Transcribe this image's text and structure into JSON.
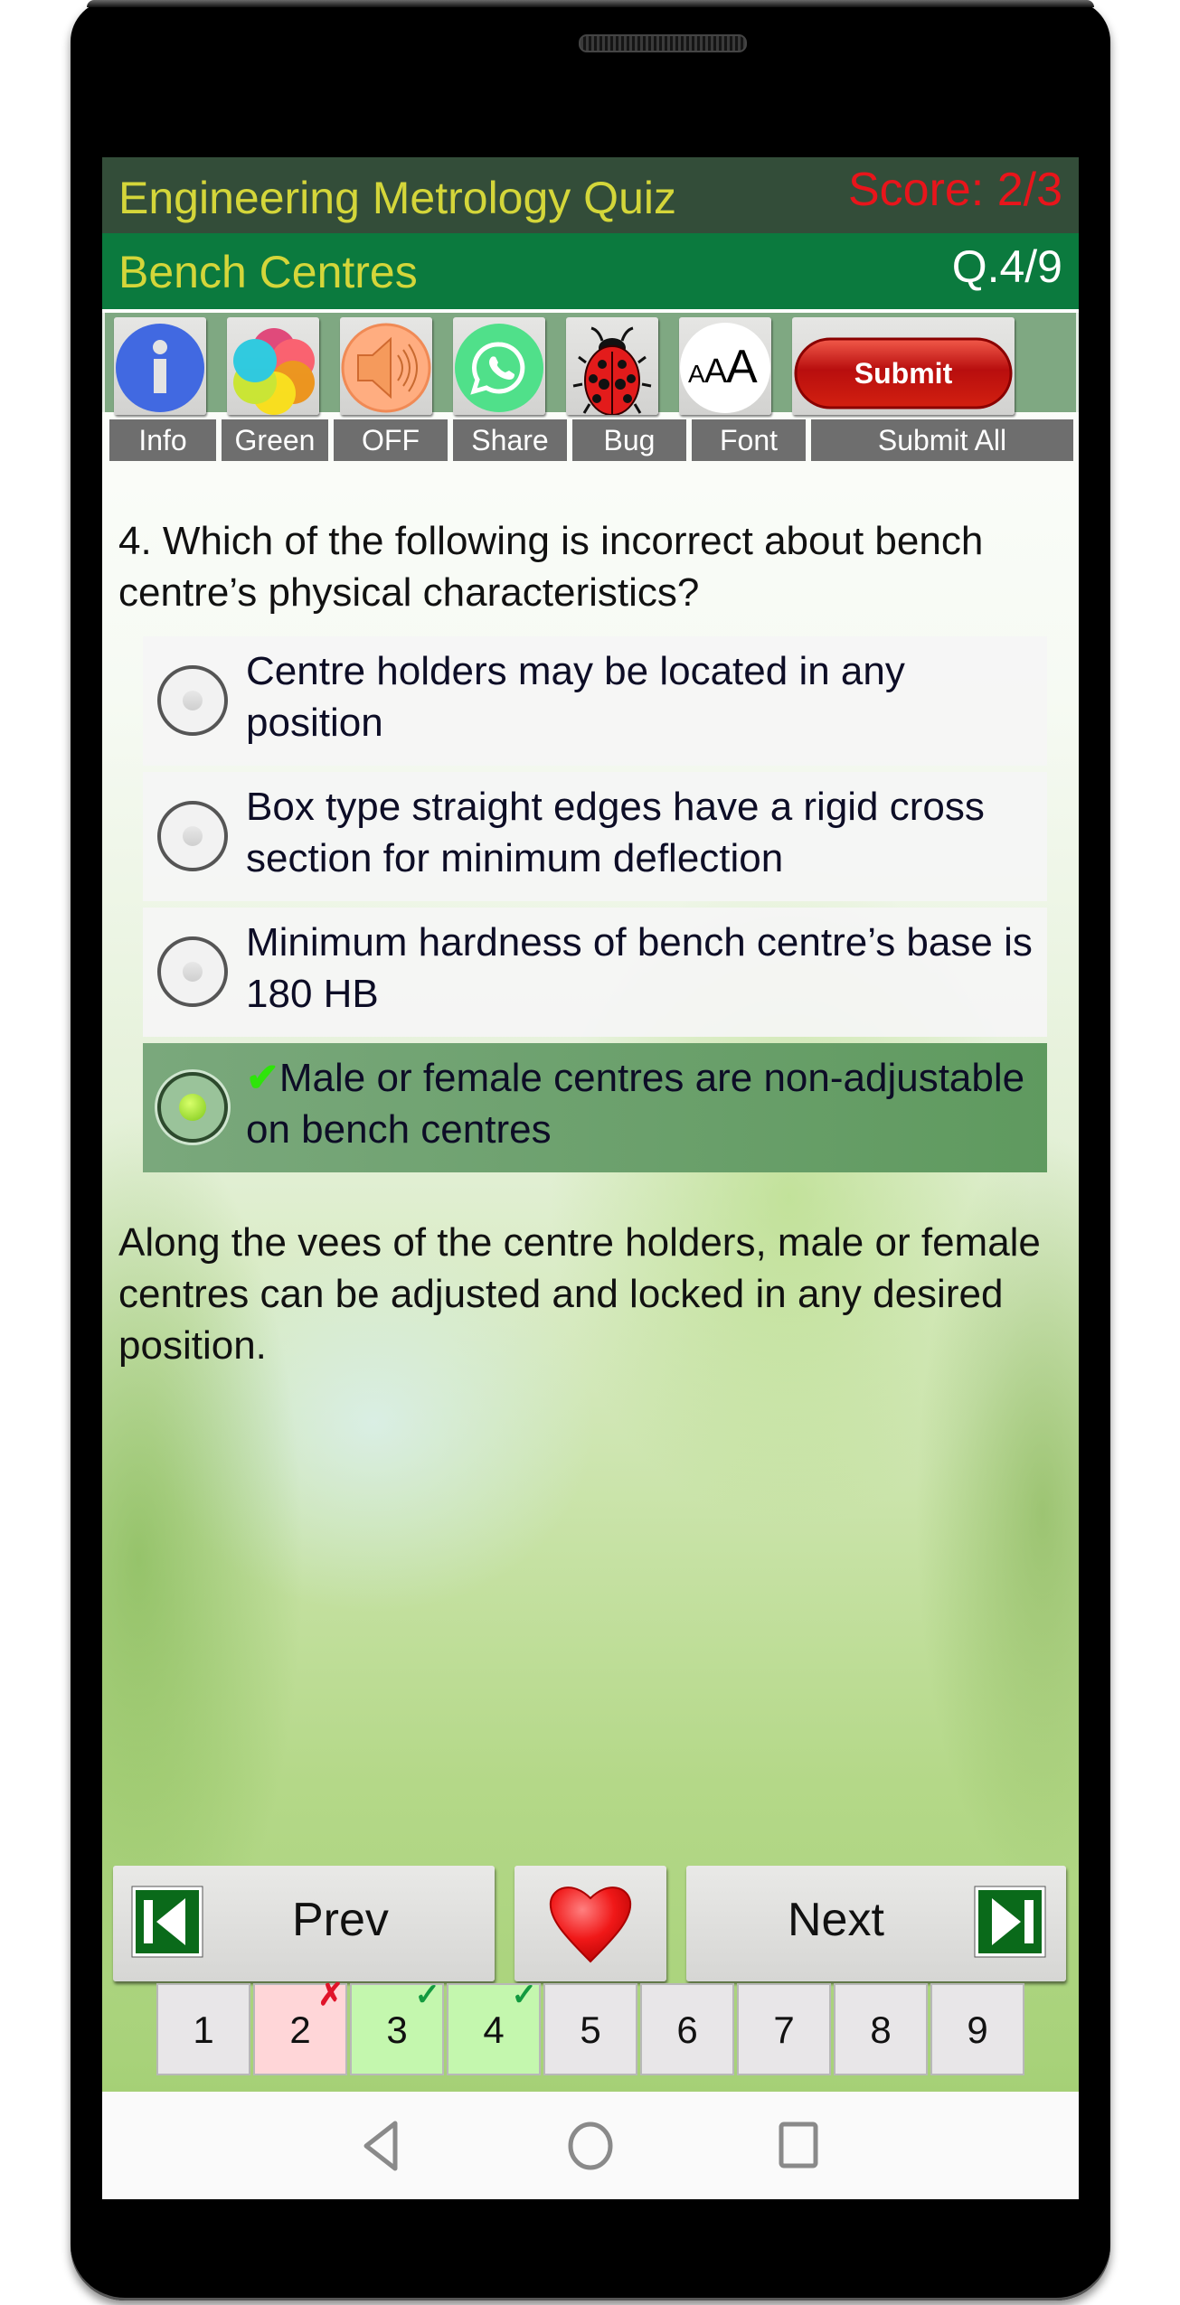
{
  "header": {
    "app_title": "Engineering Metrology Quiz",
    "score": "Score: 2/3",
    "topic": "Bench Centres",
    "question_counter": "Q.4/9"
  },
  "toolbar": {
    "buttons": [
      {
        "icon": "info-icon",
        "label": "Info"
      },
      {
        "icon": "color-theme-icon",
        "label": "Green"
      },
      {
        "icon": "speaker-icon",
        "label": "OFF"
      },
      {
        "icon": "whatsapp-share-icon",
        "label": "Share"
      },
      {
        "icon": "ladybug-icon",
        "label": "Bug"
      },
      {
        "icon": "font-size-icon",
        "label": "Font",
        "glyph": "AAA"
      },
      {
        "icon": "submit-icon",
        "label": "Submit All",
        "button_text": "Submit"
      }
    ]
  },
  "question": {
    "text": "4. Which of the following is incorrect about bench centre’s physical characteristics?",
    "options": [
      {
        "text": "Centre holders may be located in any position",
        "selected": false
      },
      {
        "text": "Box type straight edges have a rigid cross section for minimum deflection",
        "selected": false
      },
      {
        "text": "Minimum hardness of bench centre’s base is 180 HB",
        "selected": false
      },
      {
        "text": "Male or female centres are non-adjustable on bench centres",
        "selected": true,
        "correct_mark": "✔"
      }
    ],
    "explanation": "Along the vees of the centre holders, male or female centres can be adjusted and locked in any desired position."
  },
  "navigation": {
    "prev_label": "Prev",
    "next_label": "Next",
    "favorite_icon": "heart-icon"
  },
  "question_grid": [
    {
      "number": "1",
      "status": "unanswered"
    },
    {
      "number": "2",
      "status": "wrong",
      "mark": "✗"
    },
    {
      "number": "3",
      "status": "right",
      "mark": "✓"
    },
    {
      "number": "4",
      "status": "right",
      "mark": "✓"
    },
    {
      "number": "5",
      "status": "unanswered"
    },
    {
      "number": "6",
      "status": "unanswered"
    },
    {
      "number": "7",
      "status": "unanswered"
    },
    {
      "number": "8",
      "status": "unanswered"
    },
    {
      "number": "9",
      "status": "unanswered"
    }
  ],
  "colors": {
    "title_bar": "#334d39",
    "subtitle_bar": "#0b7a3e",
    "title_text": "#d4d63a",
    "score_text": "#e8151b",
    "selected_option": "#6a9f6b",
    "wrong_cell": "#ffd6d8",
    "right_cell": "#c4f7ae"
  }
}
